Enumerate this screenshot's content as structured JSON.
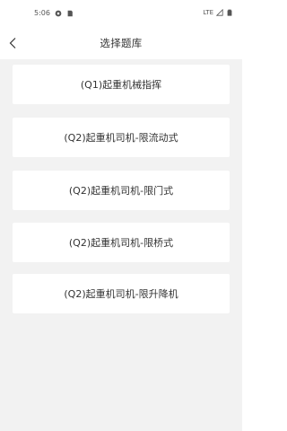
{
  "status_bar": {
    "time": "5:06",
    "network": "LTE"
  },
  "header": {
    "title": "选择题库"
  },
  "options": [
    {
      "label": "(Q1)起重机械指挥"
    },
    {
      "label": "(Q2)起重机司机-限流动式"
    },
    {
      "label": "(Q2)起重机司机-限门式"
    },
    {
      "label": "(Q2)起重机司机-限桥式"
    },
    {
      "label": "(Q2)起重机司机-限升降机"
    }
  ],
  "icons": {
    "back": "chevron-left-icon",
    "status_left": [
      "settings-dot-icon",
      "sd-card-icon"
    ],
    "status_right": [
      "signal-icon",
      "battery-icon"
    ]
  },
  "colors": {
    "background": "#f2f2f2",
    "card": "#ffffff",
    "text": "#333333"
  }
}
